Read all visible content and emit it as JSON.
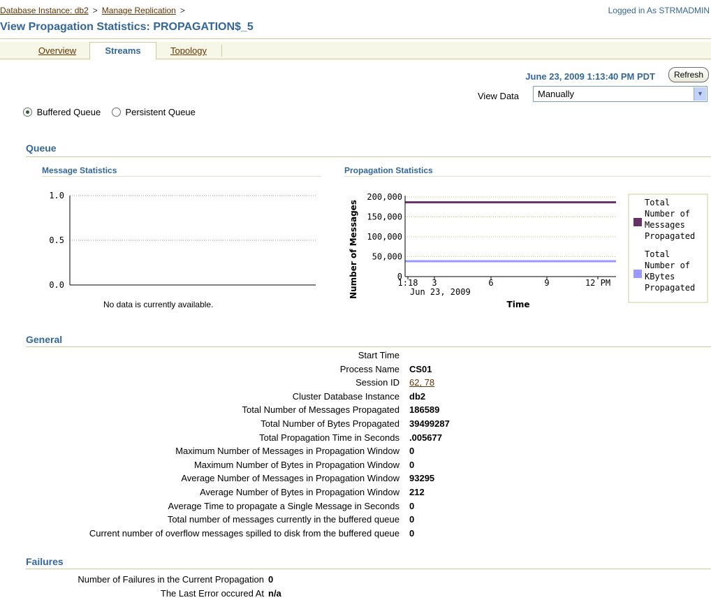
{
  "breadcrumb": {
    "items": [
      "Database Instance: db2",
      "Manage Replication"
    ],
    "separator": ">"
  },
  "logged_in": "Logged in As STRMADMIN",
  "page_title": "View Propagation Statistics: PROPAGATION$_5",
  "tabs": [
    {
      "label": "Overview",
      "active": false
    },
    {
      "label": "Streams",
      "active": true
    },
    {
      "label": "Topology",
      "active": false
    }
  ],
  "timestamp": "June 23, 2009 1:13:40 PM PDT",
  "refresh_label": "Refresh",
  "view_data": {
    "label": "View Data",
    "selected": "Manually"
  },
  "queue_type": {
    "options": [
      "Buffered Queue",
      "Persistent Queue"
    ],
    "selected": "Buffered Queue"
  },
  "queue_section": {
    "title": "Queue",
    "message_stats_title": "Message Statistics",
    "propagation_stats_title": "Propagation Statistics",
    "no_data": "No data is currently available."
  },
  "chart_data": [
    {
      "type": "line",
      "title": "Message Statistics",
      "y_ticks": [
        "1.0",
        "0.5",
        "0.0"
      ],
      "ylim": [
        0,
        1.0
      ],
      "series": [],
      "grid": true
    },
    {
      "type": "line",
      "title": "Propagation Statistics",
      "xlabel": "Time",
      "ylabel": "Number of Messages",
      "x_ticks": [
        "1:18",
        "3",
        "6",
        "9",
        "12 PM"
      ],
      "x_date_label": "Jun 23, 2009",
      "y_ticks": [
        "200,000",
        "150,000",
        "100,000",
        "50,000",
        "0"
      ],
      "ylim": [
        0,
        200000
      ],
      "series": [
        {
          "name": "Total Number of Messages Propagated",
          "color": "#663366",
          "values": [
            186589,
            186589
          ]
        },
        {
          "name": "Total Number of KBytes Propagated",
          "color": "#9999ff",
          "values": [
            38574,
            38574
          ]
        }
      ],
      "legend": "right",
      "grid": true
    }
  ],
  "general": {
    "title": "General",
    "rows": [
      {
        "label": "Start Time",
        "value": "",
        "link": false
      },
      {
        "label": "Process Name",
        "value": "CS01",
        "link": false
      },
      {
        "label": "Session ID",
        "value": "62, 78",
        "link": true
      },
      {
        "label": "Cluster Database Instance",
        "value": "db2",
        "link": false
      },
      {
        "label": "Total Number of Messages Propagated",
        "value": "186589",
        "link": false
      },
      {
        "label": "Total Number of Bytes Propagated",
        "value": "39499287",
        "link": false
      },
      {
        "label": "Total Propagation Time in Seconds",
        "value": ".005677",
        "link": false
      },
      {
        "label": "Maximum Number of Messages in Propagation Window",
        "value": "0",
        "link": false
      },
      {
        "label": "Maximum Number of Bytes in Propagation Window",
        "value": "0",
        "link": false
      },
      {
        "label": "Average Number of Messages in Propagation Window",
        "value": "93295",
        "link": false
      },
      {
        "label": "Average Number of Bytes in Propagation Window",
        "value": "212",
        "link": false
      },
      {
        "label": "Average Time to propagate a Single Message in Seconds",
        "value": "0",
        "link": false
      },
      {
        "label": "Total number of messages currently in the buffered queue",
        "value": "0",
        "link": false
      },
      {
        "label": "Current number of overflow messages spilled to disk from the buffered queue",
        "value": "0",
        "link": false
      }
    ]
  },
  "failures": {
    "title": "Failures",
    "rows": [
      {
        "label": "Number of Failures in the Current Propagation",
        "value": "0"
      },
      {
        "label": "The Last Error occured At",
        "value": "n/a"
      }
    ]
  }
}
